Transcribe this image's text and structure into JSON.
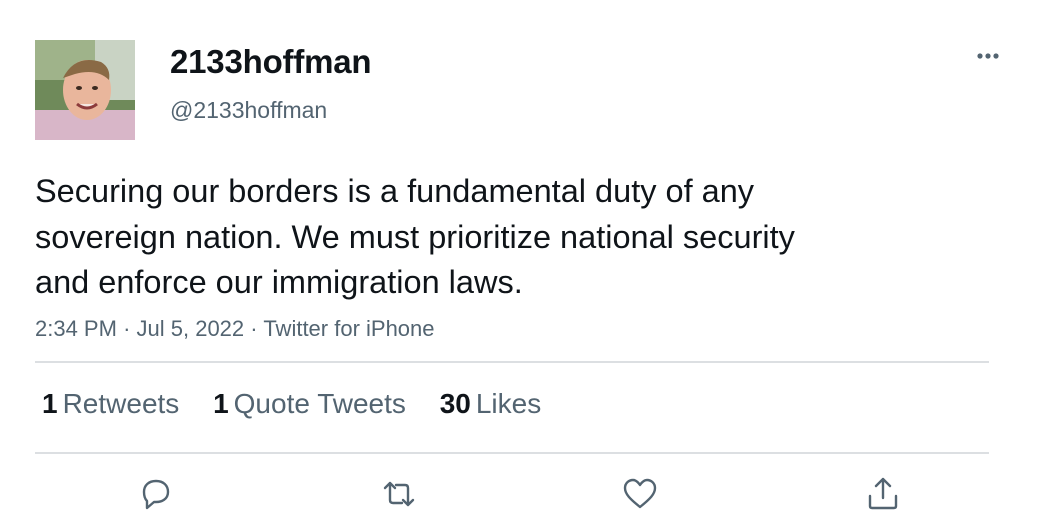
{
  "user": {
    "display_name": "2133hoffman",
    "handle": "@2133hoffman",
    "avatar_icon": "profile-photo"
  },
  "tweet": {
    "text_lines": [
      "Securing our borders is a fundamental duty of any",
      "sovereign nation. We must prioritize national security",
      "and enforce our immigration laws."
    ],
    "time": "2:34 PM",
    "separator": "·",
    "date": "Jul 5, 2022",
    "source": "Twitter for iPhone"
  },
  "stats": {
    "retweets": {
      "count": "1",
      "label": "Retweets"
    },
    "quote_tweets": {
      "count": "1",
      "label": "Quote Tweets"
    },
    "likes": {
      "count": "30",
      "label": "Likes"
    }
  },
  "actions": {
    "reply_icon": "reply-icon",
    "retweet_icon": "retweet-icon",
    "like_icon": "heart-icon",
    "share_icon": "share-icon",
    "more_icon": "more-horizontal-icon"
  },
  "colors": {
    "text_primary": "#0f1419",
    "text_secondary": "#536471",
    "divider": "#dcdfe2",
    "icon": "#536471"
  }
}
